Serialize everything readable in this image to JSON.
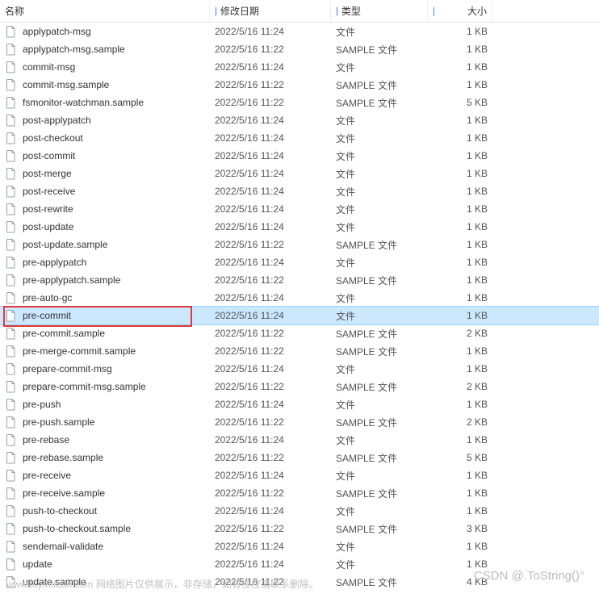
{
  "header": {
    "name": "名称",
    "date": "修改日期",
    "type": "类型",
    "size": "大小"
  },
  "types": {
    "file": "文件",
    "sample": "SAMPLE 文件"
  },
  "files": [
    {
      "name": "applypatch-msg",
      "date": "2022/5/16 11:24",
      "type_key": "file",
      "size": "1 KB"
    },
    {
      "name": "applypatch-msg.sample",
      "date": "2022/5/16 11:22",
      "type_key": "sample",
      "size": "1 KB"
    },
    {
      "name": "commit-msg",
      "date": "2022/5/16 11:24",
      "type_key": "file",
      "size": "1 KB"
    },
    {
      "name": "commit-msg.sample",
      "date": "2022/5/16 11:22",
      "type_key": "sample",
      "size": "1 KB"
    },
    {
      "name": "fsmonitor-watchman.sample",
      "date": "2022/5/16 11:22",
      "type_key": "sample",
      "size": "5 KB"
    },
    {
      "name": "post-applypatch",
      "date": "2022/5/16 11:24",
      "type_key": "file",
      "size": "1 KB"
    },
    {
      "name": "post-checkout",
      "date": "2022/5/16 11:24",
      "type_key": "file",
      "size": "1 KB"
    },
    {
      "name": "post-commit",
      "date": "2022/5/16 11:24",
      "type_key": "file",
      "size": "1 KB"
    },
    {
      "name": "post-merge",
      "date": "2022/5/16 11:24",
      "type_key": "file",
      "size": "1 KB"
    },
    {
      "name": "post-receive",
      "date": "2022/5/16 11:24",
      "type_key": "file",
      "size": "1 KB"
    },
    {
      "name": "post-rewrite",
      "date": "2022/5/16 11:24",
      "type_key": "file",
      "size": "1 KB"
    },
    {
      "name": "post-update",
      "date": "2022/5/16 11:24",
      "type_key": "file",
      "size": "1 KB"
    },
    {
      "name": "post-update.sample",
      "date": "2022/5/16 11:22",
      "type_key": "sample",
      "size": "1 KB"
    },
    {
      "name": "pre-applypatch",
      "date": "2022/5/16 11:24",
      "type_key": "file",
      "size": "1 KB"
    },
    {
      "name": "pre-applypatch.sample",
      "date": "2022/5/16 11:22",
      "type_key": "sample",
      "size": "1 KB"
    },
    {
      "name": "pre-auto-gc",
      "date": "2022/5/16 11:24",
      "type_key": "file",
      "size": "1 KB"
    },
    {
      "name": "pre-commit",
      "date": "2022/5/16 11:24",
      "type_key": "file",
      "size": "1 KB",
      "selected": true,
      "highlight": true
    },
    {
      "name": "pre-commit.sample",
      "date": "2022/5/16 11:22",
      "type_key": "sample",
      "size": "2 KB"
    },
    {
      "name": "pre-merge-commit.sample",
      "date": "2022/5/16 11:22",
      "type_key": "sample",
      "size": "1 KB"
    },
    {
      "name": "prepare-commit-msg",
      "date": "2022/5/16 11:24",
      "type_key": "file",
      "size": "1 KB"
    },
    {
      "name": "prepare-commit-msg.sample",
      "date": "2022/5/16 11:22",
      "type_key": "sample",
      "size": "2 KB"
    },
    {
      "name": "pre-push",
      "date": "2022/5/16 11:24",
      "type_key": "file",
      "size": "1 KB"
    },
    {
      "name": "pre-push.sample",
      "date": "2022/5/16 11:22",
      "type_key": "sample",
      "size": "2 KB"
    },
    {
      "name": "pre-rebase",
      "date": "2022/5/16 11:24",
      "type_key": "file",
      "size": "1 KB"
    },
    {
      "name": "pre-rebase.sample",
      "date": "2022/5/16 11:22",
      "type_key": "sample",
      "size": "5 KB"
    },
    {
      "name": "pre-receive",
      "date": "2022/5/16 11:24",
      "type_key": "file",
      "size": "1 KB"
    },
    {
      "name": "pre-receive.sample",
      "date": "2022/5/16 11:22",
      "type_key": "sample",
      "size": "1 KB"
    },
    {
      "name": "push-to-checkout",
      "date": "2022/5/16 11:24",
      "type_key": "file",
      "size": "1 KB"
    },
    {
      "name": "push-to-checkout.sample",
      "date": "2022/5/16 11:22",
      "type_key": "sample",
      "size": "3 KB"
    },
    {
      "name": "sendemail-validate",
      "date": "2022/5/16 11:24",
      "type_key": "file",
      "size": "1 KB"
    },
    {
      "name": "update",
      "date": "2022/5/16 11:24",
      "type_key": "file",
      "size": "1 KB"
    },
    {
      "name": "update.sample",
      "date": "2022/5/16 11:22",
      "type_key": "sample",
      "size": "4 KB"
    }
  ],
  "watermark1": "CSDN @.ToString()°",
  "watermark2": "www.toymoban.com 网络图片仅供展示，非存储，如有侵权请联系删除。"
}
